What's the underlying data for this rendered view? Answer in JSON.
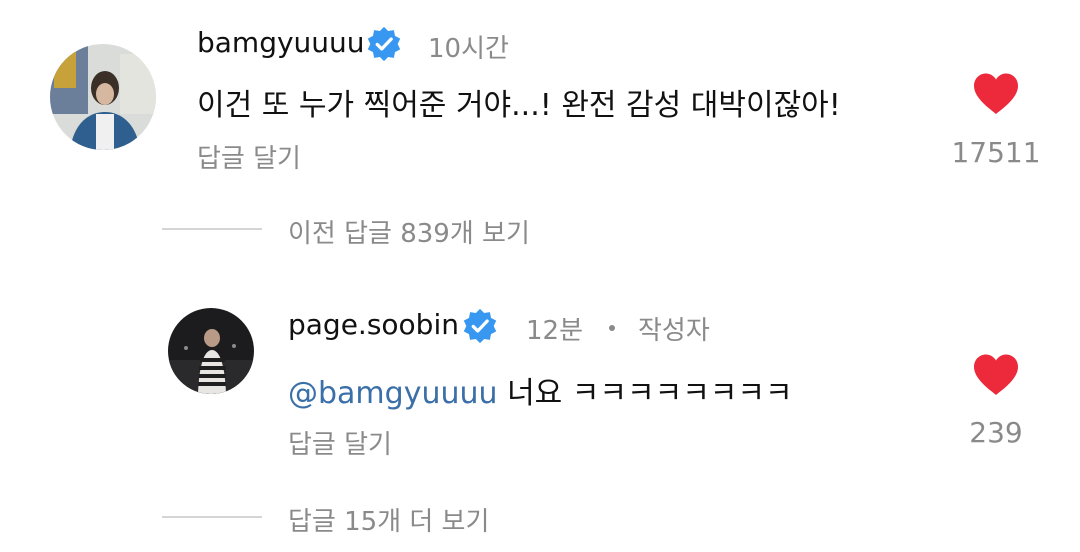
{
  "comment": {
    "username": "bamgyuuuu",
    "verified": true,
    "timestamp": "10시간",
    "text": "이건 또 누가 찍어준 거야...! 완전 감성 대박이잖아!",
    "reply_action": "답글 달기",
    "likes": "17511",
    "liked": true
  },
  "view_previous_replies": "이전 답글 839개 보기",
  "reply": {
    "username": "page.soobin",
    "verified": true,
    "timestamp": "12분",
    "author_label": "작성자",
    "mention": "@bamgyuuuu",
    "text": "너요 ㅋㅋㅋㅋㅋㅋㅋㅋ",
    "reply_action": "답글 달기",
    "likes": "239",
    "liked": true
  },
  "view_more_replies": "답글 15개 더 보기",
  "colors": {
    "verified_badge": "#3897f0",
    "heart": "#ed2a3b",
    "mention": "#3b6fa8",
    "secondary_text": "#8a8a8a"
  },
  "icons": {
    "verified": "verified-badge-icon",
    "like": "heart-filled-icon"
  }
}
